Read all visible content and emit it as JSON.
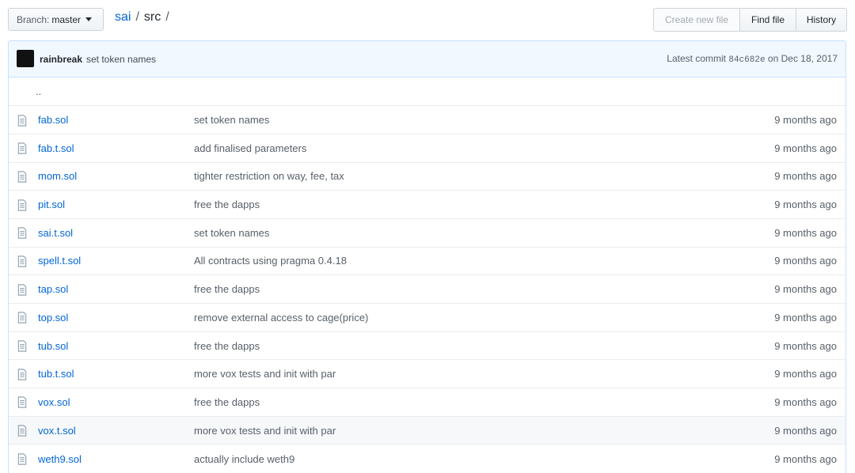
{
  "branch": {
    "prefix": "Branch:",
    "name": "master"
  },
  "breadcrumb": {
    "repo": "sai",
    "sep1": "/",
    "dir": "src",
    "sep2": "/"
  },
  "actions": {
    "create_new_file": "Create new file",
    "find_file": "Find file",
    "history": "History"
  },
  "commit": {
    "author": "rainbreak",
    "message": "set token names",
    "latest_label": "Latest commit",
    "sha": "84c682e",
    "on_label": "on",
    "date": "Dec 18, 2017"
  },
  "parent_dir": "..",
  "files": [
    {
      "name": "fab.sol",
      "message": "set token names",
      "age": "9 months ago",
      "icon": "file-icon"
    },
    {
      "name": "fab.t.sol",
      "message": "add finalised parameters",
      "age": "9 months ago",
      "icon": "file-icon"
    },
    {
      "name": "mom.sol",
      "message": "tighter restriction on way, fee, tax",
      "age": "9 months ago",
      "icon": "file-icon"
    },
    {
      "name": "pit.sol",
      "message": "free the dapps",
      "age": "9 months ago",
      "icon": "file-icon"
    },
    {
      "name": "sai.t.sol",
      "message": "set token names",
      "age": "9 months ago",
      "icon": "file-icon"
    },
    {
      "name": "spell.t.sol",
      "message": "All contracts using pragma 0.4.18",
      "age": "9 months ago",
      "icon": "file-icon"
    },
    {
      "name": "tap.sol",
      "message": "free the dapps",
      "age": "9 months ago",
      "icon": "file-icon"
    },
    {
      "name": "top.sol",
      "message": "remove external access to cage(price)",
      "age": "9 months ago",
      "icon": "file-icon"
    },
    {
      "name": "tub.sol",
      "message": "free the dapps",
      "age": "9 months ago",
      "icon": "file-icon"
    },
    {
      "name": "tub.t.sol",
      "message": "more vox tests and init with par",
      "age": "9 months ago",
      "icon": "file-icon"
    },
    {
      "name": "vox.sol",
      "message": "free the dapps",
      "age": "9 months ago",
      "icon": "file-icon"
    },
    {
      "name": "vox.t.sol",
      "message": "more vox tests and init with par",
      "age": "9 months ago",
      "icon": "file-icon",
      "highlighted": true
    },
    {
      "name": "weth9.sol",
      "message": "actually include weth9",
      "age": "9 months ago",
      "icon": "file-icon"
    }
  ]
}
